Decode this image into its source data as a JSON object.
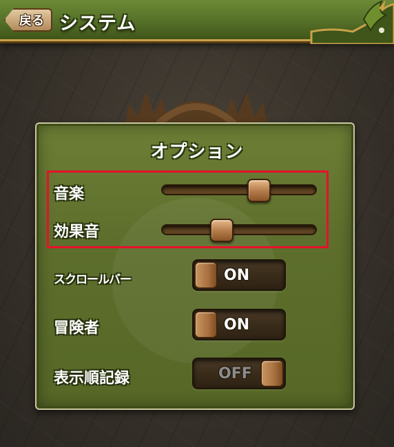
{
  "header": {
    "back_label": "戻る",
    "title": "システム"
  },
  "panel": {
    "title": "オプション",
    "sliders": [
      {
        "label": "音楽",
        "level": 0.63
      },
      {
        "label": "効果音",
        "level": 0.39
      }
    ],
    "toggles": [
      {
        "label": "スクロールバー",
        "state": "ON"
      },
      {
        "label": "冒険者",
        "state": "ON"
      },
      {
        "label": "表示順記録",
        "state": "OFF"
      }
    ]
  },
  "colors": {
    "highlight": "#e8102a",
    "panel_green": "#5e6f2d",
    "header_green": "#557028"
  }
}
